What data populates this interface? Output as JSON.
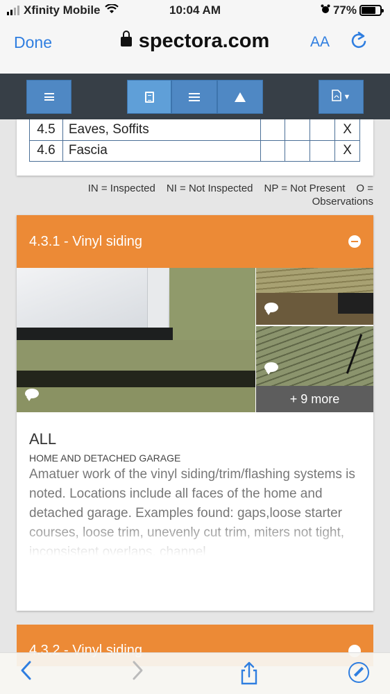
{
  "status_bar": {
    "carrier": "Xfinity Mobile",
    "time": "10:04 AM",
    "battery": "77%",
    "battery_level": 0.77
  },
  "browser": {
    "done_label": "Done",
    "url": "spectora.com",
    "text_size_label": "AA"
  },
  "toolbar": {
    "buttons": [
      "menu",
      "report-document",
      "summary-list",
      "defects-warning",
      "pdf-download"
    ],
    "active": "report-document"
  },
  "inspection_table": {
    "rows": [
      {
        "number": "4.5",
        "name": "Eaves, Soffits",
        "in": "",
        "ni": "",
        "np": "",
        "o": "X"
      },
      {
        "number": "4.6",
        "name": "Fascia",
        "in": "",
        "ni": "",
        "np": "",
        "o": "X"
      }
    ]
  },
  "legend": {
    "in": "IN = Inspected",
    "ni": "NI = Not Inspected",
    "np": "NP = Not Present",
    "o": "O = Observations"
  },
  "comment": {
    "title": "4.3.1 - Vinyl siding",
    "more_photos": "+ 9 more",
    "location": "ALL",
    "sublocation": "HOME AND DETACHED GARAGE",
    "text": "Amatuer work of the vinyl siding/trim/flashing systems is noted. Locations include all faces of the home and detached garage. Examples found: gaps,loose starter courses, loose trim, unevenly cut trim, miters not tight, inconsistent overlaps, channel"
  },
  "next_comment": {
    "title": "4.3.2 - Vinyl siding"
  },
  "colors": {
    "accent_orange": "#ec8a36",
    "toolbar_dark": "#373f47",
    "button_blue": "#4f88c4",
    "ios_blue": "#2f7ee0"
  }
}
